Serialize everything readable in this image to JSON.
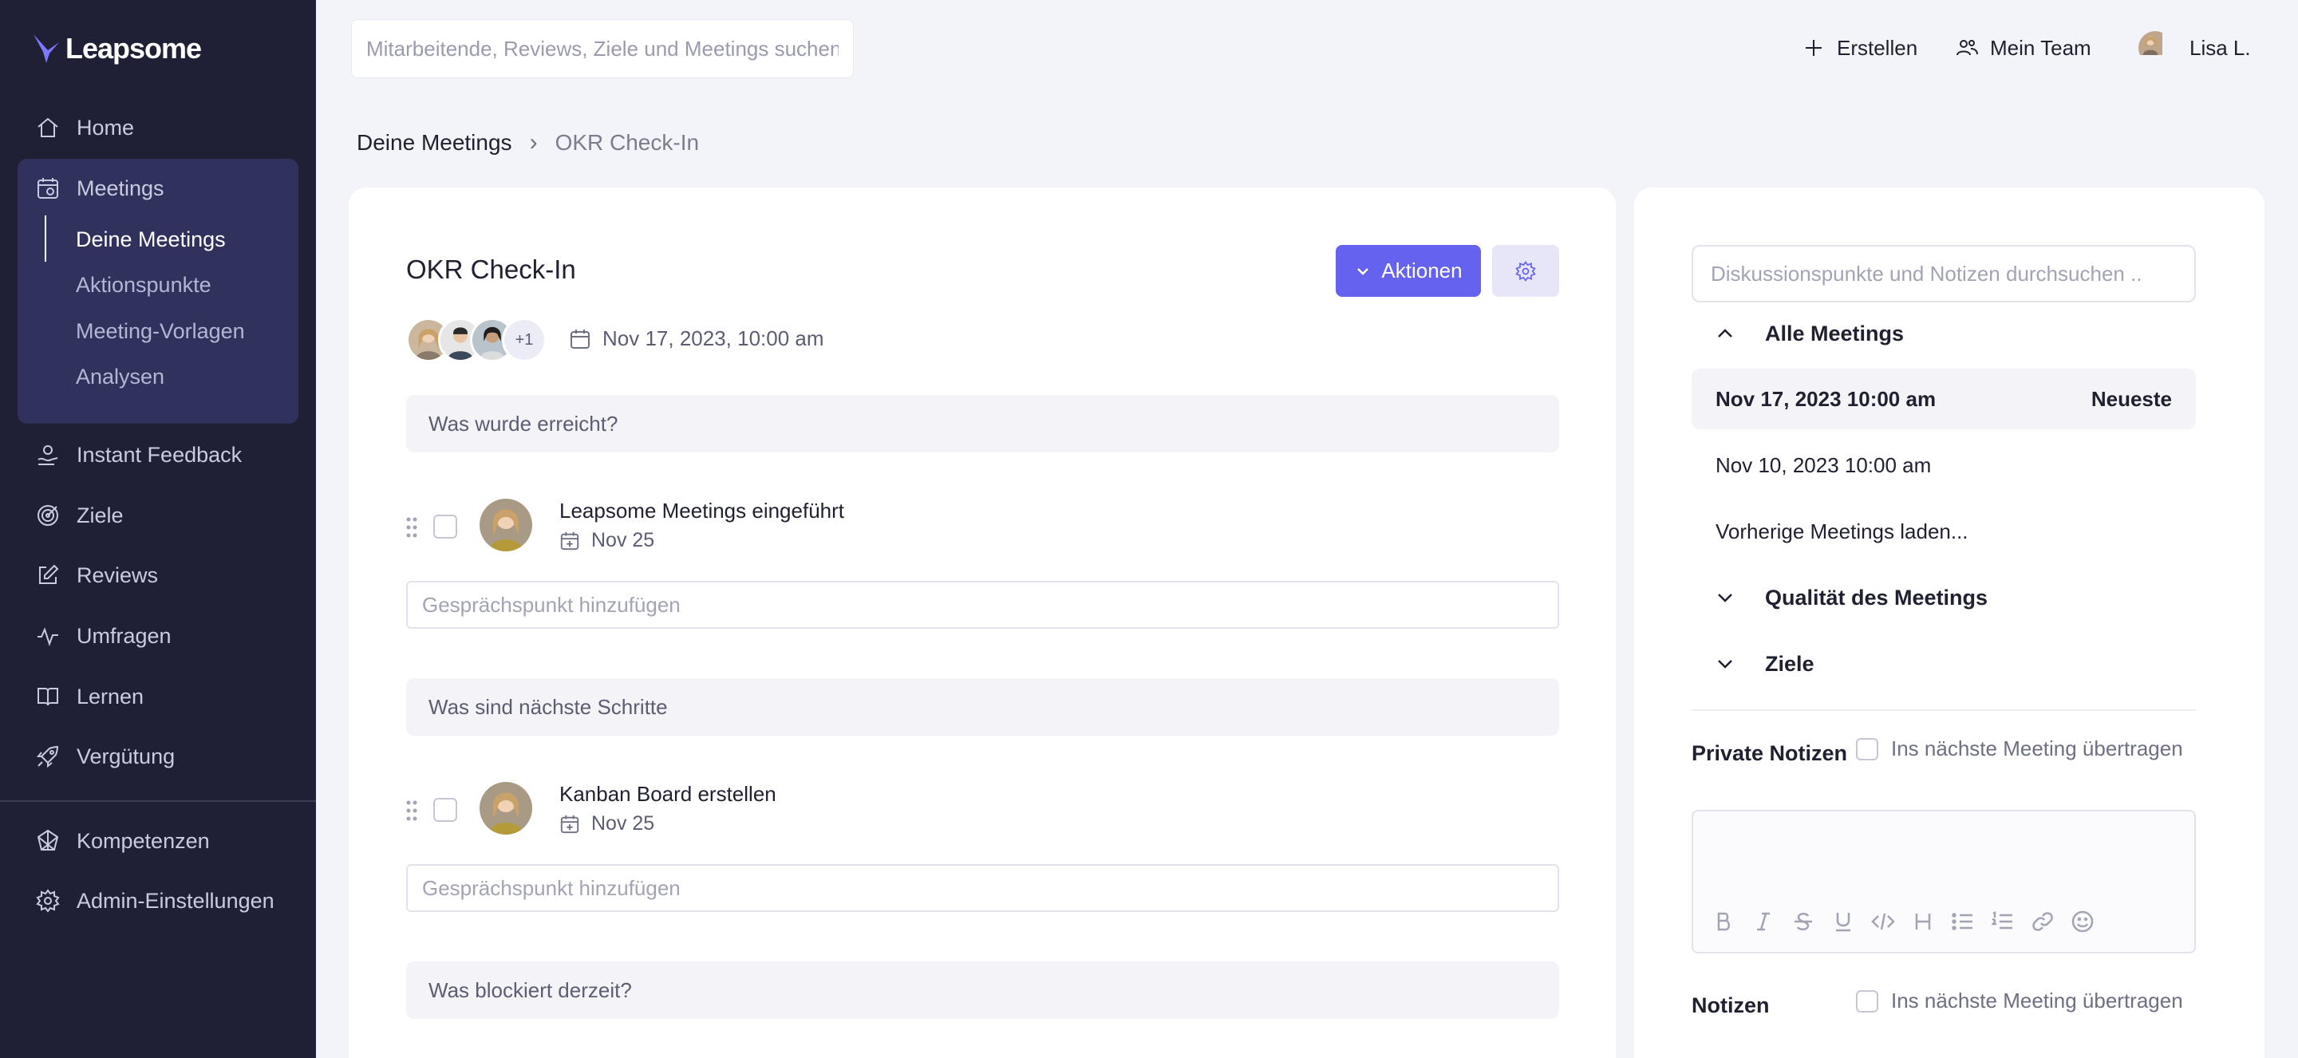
{
  "brand": {
    "name": "Leapsome",
    "accent": "#6562f0",
    "sidebar_bg": "#1f2035"
  },
  "sidebar": {
    "items": [
      {
        "label": "Home",
        "icon": "home-icon"
      },
      {
        "label": "Meetings",
        "icon": "meetings-icon"
      },
      {
        "label": "Instant Feedback",
        "icon": "feedback-icon"
      },
      {
        "label": "Ziele",
        "icon": "target-icon"
      },
      {
        "label": "Reviews",
        "icon": "edit-icon"
      },
      {
        "label": "Umfragen",
        "icon": "pulse-icon"
      },
      {
        "label": "Lernen",
        "icon": "book-icon"
      },
      {
        "label": "Vergütung",
        "icon": "rocket-icon"
      },
      {
        "label": "Kompetenzen",
        "icon": "competency-icon"
      },
      {
        "label": "Admin-Einstellungen",
        "icon": "gear-icon"
      }
    ],
    "meetings_sub": [
      "Deine Meetings",
      "Aktionspunkte",
      "Meeting-Vorlagen",
      "Analysen"
    ]
  },
  "topbar": {
    "search_placeholder": "Mitarbeitende, Reviews, Ziele und Meetings suchen",
    "create_label": "Erstellen",
    "team_label": "Mein Team",
    "user_label": "Lisa L."
  },
  "breadcrumb": {
    "parent": "Deine Meetings",
    "separator": "›",
    "current": "OKR Check-In"
  },
  "meeting": {
    "title": "OKR Check-In",
    "actions_label": "Aktionen",
    "extra_participants": "+1",
    "date": "Nov 17, 2023, 10:00 am",
    "add_placeholder": "Gesprächspunkt hinzufügen",
    "sections": [
      {
        "heading": "Was wurde erreicht?",
        "point": {
          "title": "Leapsome Meetings eingeführt",
          "due": "Nov 25"
        }
      },
      {
        "heading": "Was sind nächste Schritte",
        "point": {
          "title": "Kanban Board erstellen",
          "due": "Nov 25"
        }
      },
      {
        "heading": "Was blockiert derzeit?"
      }
    ]
  },
  "notes_panel": {
    "search_placeholder": "Diskussionspunkte und Notizen durchsuchen ..",
    "all_meetings": "Alle Meetings",
    "entries": [
      {
        "date": "Nov 17, 2023 10:00 am",
        "badge": "Neueste"
      },
      {
        "date": "Nov 10, 2023 10:00 am"
      }
    ],
    "load_previous": "Vorherige Meetings laden...",
    "quality_label": "Qualität des Meetings",
    "goals_label": "Ziele",
    "private_notes_label": "Private Notizen",
    "notes_label": "Notizen",
    "carry_over_label": "Ins nächste Meeting übertragen"
  }
}
